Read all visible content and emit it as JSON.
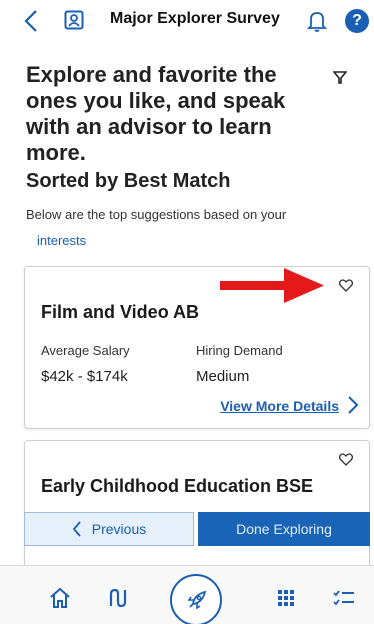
{
  "header": {
    "title": "Major Explorer Survey",
    "icons": [
      "back-chevron-icon",
      "contact-card-icon",
      "bell-icon",
      "help-icon"
    ],
    "help_label": "?"
  },
  "intro": {
    "headline": "Explore and favorite the ones you like, and speak with an advisor to learn more."
  },
  "section": {
    "title": "Sorted by Best Match",
    "description": "Below are the top suggestions based on your",
    "link": "interests"
  },
  "cards": [
    {
      "name": "Film and Video AB",
      "salary_label": "Average Salary",
      "salary_value": "$42k - $174k",
      "demand_label": "Hiring Demand",
      "demand_value": "Medium",
      "more_label": "View More Details"
    },
    {
      "name": "Early Childhood Education BSE"
    }
  ],
  "actions": {
    "previous": "Previous",
    "done": "Done Exploring"
  },
  "bottom_nav": {
    "items": [
      "home-icon",
      "route-icon",
      "rocket-icon",
      "grid-icon",
      "checklist-icon"
    ]
  },
  "colors": {
    "accent": "#1a5fb4",
    "annotation_arrow": "#e41a1a"
  }
}
